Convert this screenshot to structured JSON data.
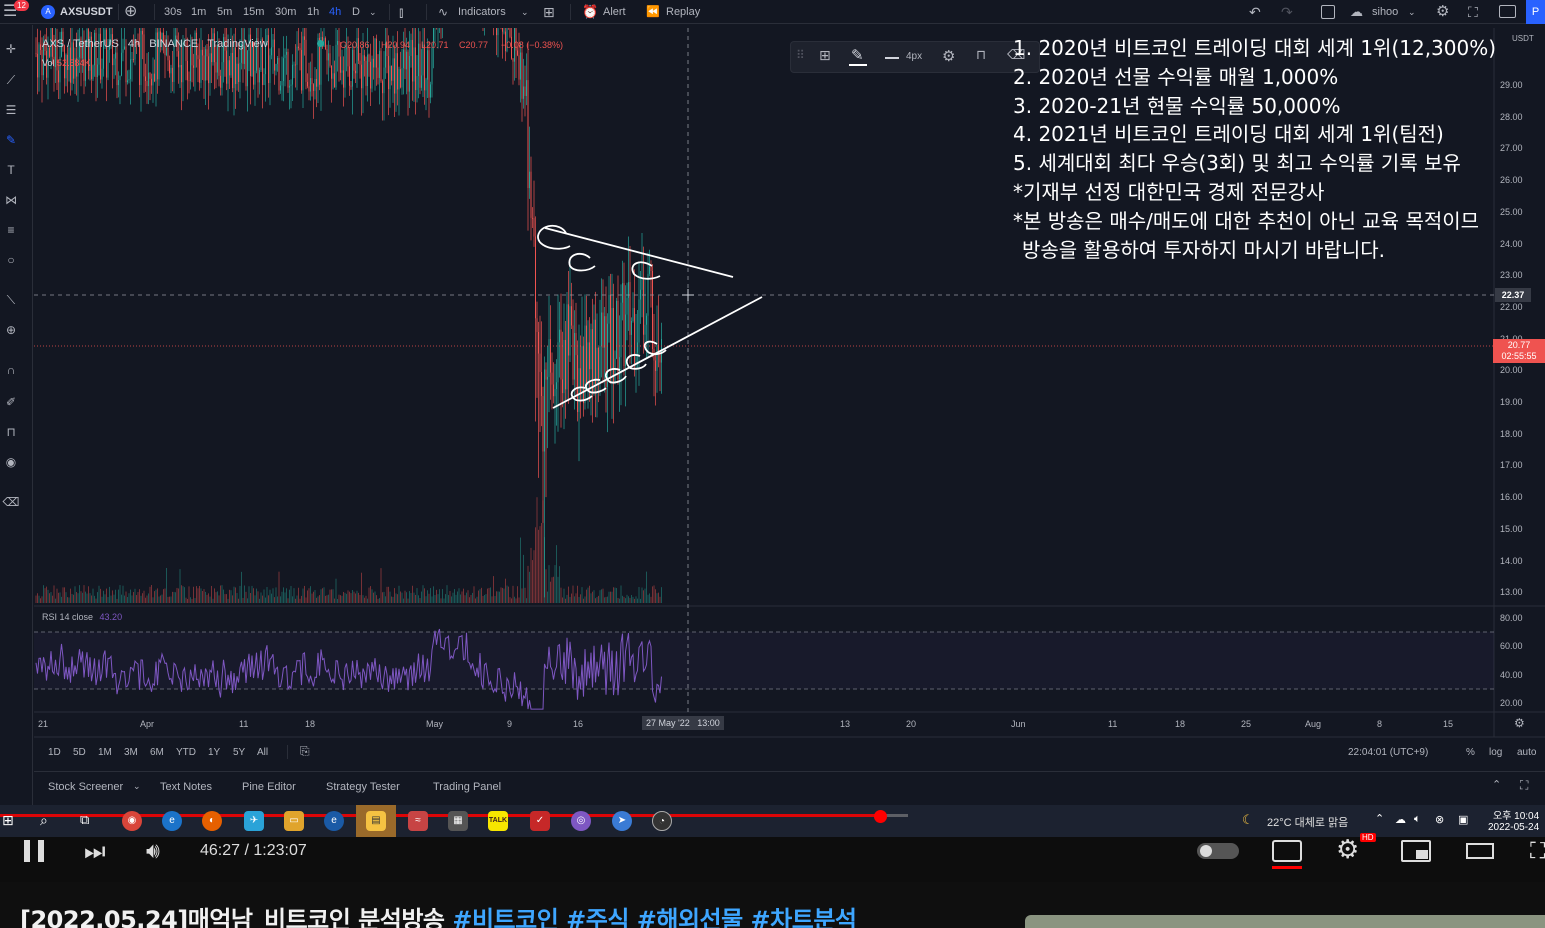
{
  "topbar": {
    "notif_count": "12",
    "symbol": "AXSUSDT",
    "intervals": [
      "30s",
      "1m",
      "5m",
      "15m",
      "30m",
      "1h",
      "4h",
      "D"
    ],
    "active_interval": "4h",
    "indicators_label": "Indicators",
    "alert_label": "Alert",
    "replay_label": "Replay",
    "user": "sihoo",
    "blue_button": "P"
  },
  "legend": {
    "pair": "AXS / TetherUS",
    "interval": "4h",
    "exchange": "BINANCE",
    "source": "TradingView",
    "o": "O20.86",
    "h": "H20.94",
    "l": "L20.71",
    "c": "C20.77",
    "chg": "−0.08 (−0.38%)",
    "vol_label": "Vol",
    "vol_value": "52.584K",
    "rsi_label": "RSI 14 close",
    "rsi_value": "43.20"
  },
  "drawing_toolbar": {
    "width_label": "4px"
  },
  "overlay_lines": [
    "1. 2020년 비트코인 트레이딩 대회 세계 1위(12,300%)",
    "2. 2020년 선물 수익률 매월 1,000%",
    "3. 2020-21년 현물 수익률 50,000%",
    "4. 2021년 비트코인 트레이딩 대회 세계 1위(팀전)",
    "5. 세계대회 최다 우승(3회) 및 최고 수익률 기록 보유",
    "*기재부 선정 대한민국 경제 전문강사",
    "*본 방송은 매수/매도에 대한 추천이 아닌 교육 목적이므",
    "방송을 활용하여 투자하지 마시기 바랍니다."
  ],
  "price_axis": {
    "unit": "USDT",
    "ticks": [
      "29.00",
      "28.00",
      "27.00",
      "26.00",
      "25.00",
      "24.00",
      "23.00",
      "22.00",
      "21.00",
      "20.00",
      "19.00",
      "18.00",
      "17.00",
      "16.00",
      "15.00",
      "14.00",
      "13.00"
    ],
    "crosshair_price": "22.37",
    "last_price": "20.77",
    "countdown": "02:55:55",
    "rsi_ticks": [
      "80.00",
      "60.00",
      "40.00",
      "20.00"
    ]
  },
  "time_axis": {
    "labels": [
      "21",
      "Apr",
      "11",
      "18",
      "May",
      "9",
      "16",
      "13",
      "20",
      "Jun",
      "11",
      "18",
      "25",
      "Aug",
      "8",
      "15"
    ],
    "crosshair_label": "27 May '22   13:00"
  },
  "range_bar": {
    "ranges": [
      "1D",
      "5D",
      "1M",
      "3M",
      "6M",
      "YTD",
      "1Y",
      "5Y",
      "All"
    ],
    "clock": "22:04:01 (UTC+9)",
    "pct": "%",
    "log": "log",
    "auto": "auto"
  },
  "bottom_tabs": [
    "Stock Screener",
    "Text Notes",
    "Pine Editor",
    "Strategy Tester",
    "Trading Panel"
  ],
  "taskbar": {
    "weather": "22°C 대체로 맑음",
    "time": "오후 10:04",
    "date": "2022-05-24",
    "kakao": "TALK"
  },
  "player": {
    "time": "46:27 / 1:23:07",
    "hd": "HD"
  },
  "video_title": {
    "main": "[2022.05.24]매억남_비트코인 분석방송 ",
    "tags": "#비트코인 #주식 #해외선물 #차트분석"
  },
  "colors": {
    "bg": "#131722",
    "up": "#26a69a",
    "down": "#ef5350",
    "rsi": "#7e57c2",
    "accent": "#2962ff"
  }
}
